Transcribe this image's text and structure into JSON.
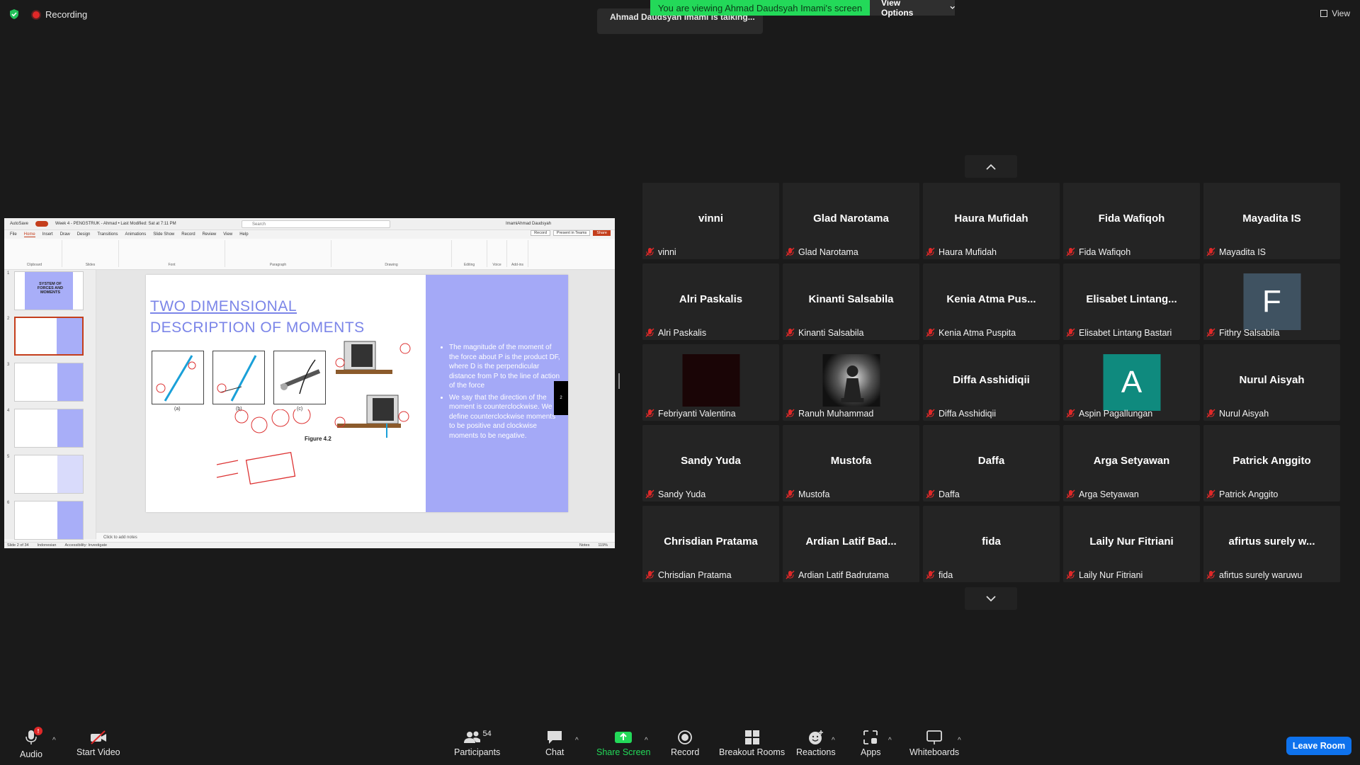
{
  "top": {
    "recording": "Recording",
    "talking": "Ahmad Daudsyah Imami is talking...",
    "banner": "You are viewing Ahmad Daudsyah Imami's screen",
    "view_options": "View Options",
    "view": "View"
  },
  "share": {
    "title_left": "AutoSave",
    "autosave_state": "On",
    "doc_title": "Week 4 - PENGSTRUK - Ahmad • Last Modified: Sat at 7:11 PM",
    "search_placeholder": "Search",
    "user": "ImamiAhmad Daudsyah",
    "menu": [
      "File",
      "Home",
      "Insert",
      "Draw",
      "Design",
      "Transitions",
      "Animations",
      "Slide Show",
      "Record",
      "Review",
      "View",
      "Help"
    ],
    "record_btn": "Record",
    "present_btn": "Present in Teams",
    "share_btn": "Share",
    "ribbon_groups": [
      "Clipboard",
      "Slides",
      "Font",
      "Paragraph",
      "Drawing",
      "Editing",
      "Voice",
      "Add-ins"
    ],
    "slide": {
      "title_line1": "TWO DIMENSIONAL",
      "title_line2": "DESCRIPTION OF MOMENTS",
      "bullet1": "The magnitude of the moment of the force about P is the product DF, where D is the perpendicular distance from P to the line of action of the force",
      "bullet2": "We say that the direction of the moment is counterclockwise. We define counterclockwise moments to be positive and clockwise moments to be negative.",
      "fig_caption": "Figure 4.2",
      "fig_a": "(a)",
      "fig_b": "(b)",
      "fig_c": "(c)",
      "page_tab": "2"
    },
    "thumb1_title": "SYSTEM OF FORCES AND MOMENTS",
    "notes": "Click to add notes",
    "status_slide": "Slide 2 of 34",
    "status_lang": "Indonesian",
    "status_access": "Accessibility: Investigate",
    "status_notes": "Notes",
    "zoom": "119%"
  },
  "participants": [
    {
      "center": "vinni",
      "name": "vinni"
    },
    {
      "center": "Glad Narotama",
      "name": "Glad Narotama"
    },
    {
      "center": "Haura Mufidah",
      "name": "Haura Mufidah"
    },
    {
      "center": "Fida Wafiqoh",
      "name": "Fida Wafiqoh"
    },
    {
      "center": "Mayadita IS",
      "name": "Mayadita IS"
    },
    {
      "center": "Alri Paskalis",
      "name": "Alri Paskalis"
    },
    {
      "center": "Kinanti Salsabila",
      "name": "Kinanti Salsabila"
    },
    {
      "center": "Kenia Atma Pus...",
      "name": "Kenia Atma Puspita"
    },
    {
      "center": "Elisabet  Lintang...",
      "name": "Elisabet Lintang Bastari"
    },
    {
      "center": "",
      "name": "Fithry Salsabila",
      "letter": "F",
      "color": "#3f5261"
    },
    {
      "center": "",
      "name": "Febriyanti Valentina",
      "video": "dark"
    },
    {
      "center": "",
      "name": "Ranuh Muhammad",
      "video": "chess"
    },
    {
      "center": "Diffa Asshidiqii",
      "name": "Diffa Asshidiqii"
    },
    {
      "center": "",
      "name": "Aspin Pagallungan",
      "letter": "A",
      "color": "#0f8a7e"
    },
    {
      "center": "Nurul Aisyah",
      "name": "Nurul Aisyah"
    },
    {
      "center": "Sandy Yuda",
      "name": "Sandy Yuda"
    },
    {
      "center": "Mustofa",
      "name": "Mustofa"
    },
    {
      "center": "Daffa",
      "name": "Daffa"
    },
    {
      "center": "Arga Setyawan",
      "name": "Arga Setyawan"
    },
    {
      "center": "Patrick Anggito",
      "name": "Patrick Anggito"
    },
    {
      "center": "Chrisdian Pratama",
      "name": "Chrisdian Pratama"
    },
    {
      "center": "Ardian Latif Bad...",
      "name": "Ardian Latif Badrutama"
    },
    {
      "center": "fida",
      "name": "fida"
    },
    {
      "center": "Laily Nur Fitriani",
      "name": "Laily Nur Fitriani"
    },
    {
      "center": "afirtus surely w...",
      "name": "afirtus surely waruwu"
    }
  ],
  "toolbar": {
    "audio": "Audio",
    "audio_badge": "!",
    "start_video": "Start Video",
    "participants": "Participants",
    "participants_count": "54",
    "chat": "Chat",
    "share_screen": "Share Screen",
    "record": "Record",
    "breakout": "Breakout Rooms",
    "reactions": "Reactions",
    "apps": "Apps",
    "whiteboards": "Whiteboards",
    "leave": "Leave Room"
  },
  "colors": {
    "banner_green": "#23d959",
    "share_green": "#23d959",
    "leave_blue": "#0e72ed",
    "mute_red": "#e02828",
    "slide_band": "#a4a9f7",
    "slide_title": "#7b85e8"
  }
}
